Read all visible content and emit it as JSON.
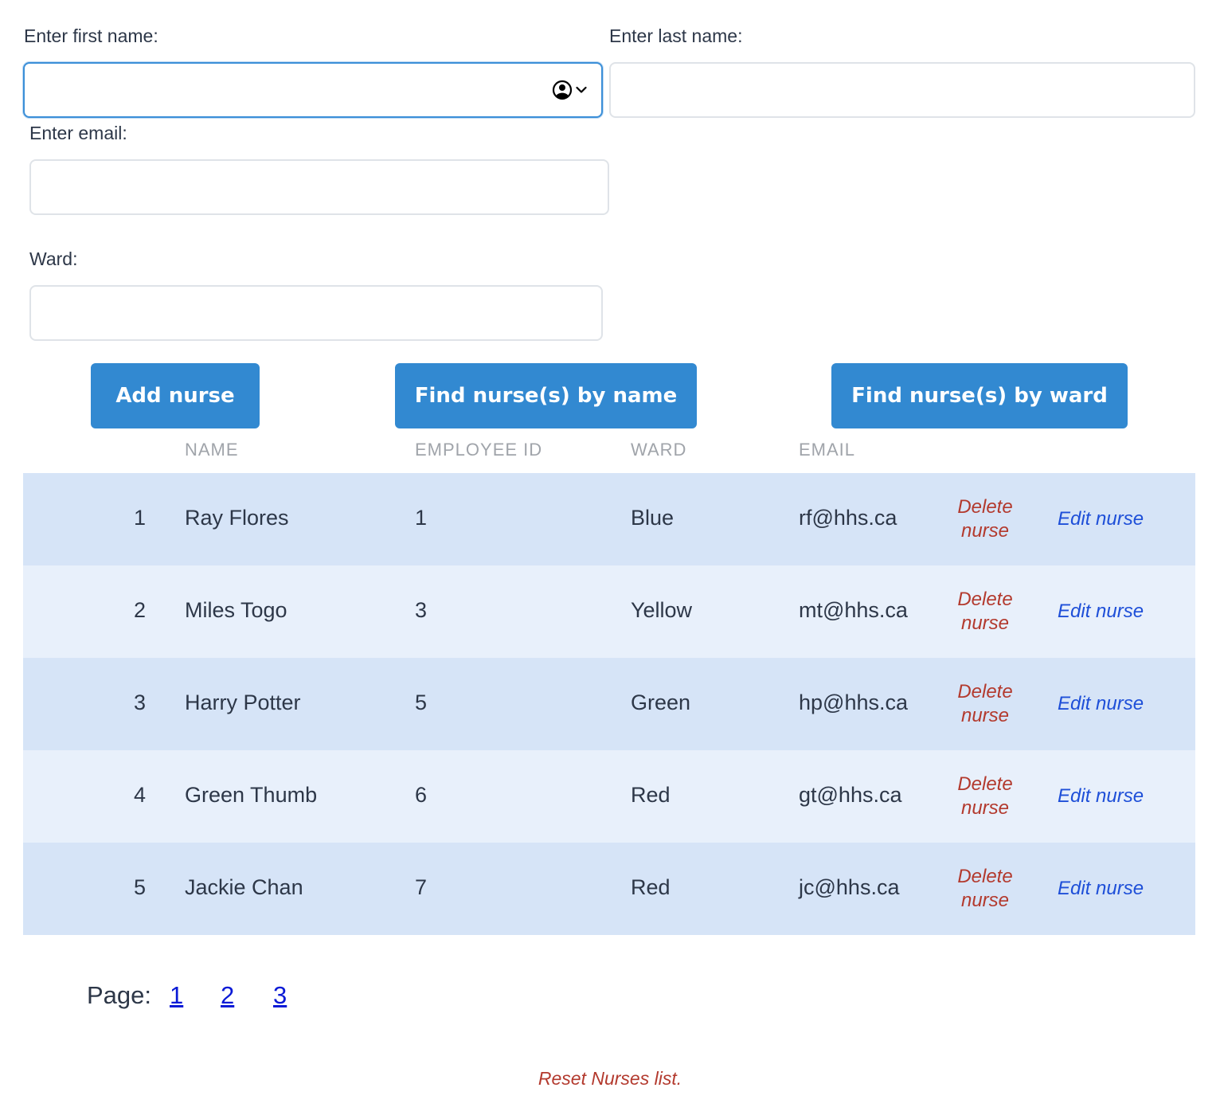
{
  "form": {
    "first_name_label": "Enter first name:",
    "last_name_label": "Enter last name:",
    "email_label": "Enter email:",
    "ward_label": "Ward:",
    "first_name_value": "",
    "last_name_value": "",
    "email_value": "",
    "ward_value": ""
  },
  "buttons": {
    "add": "Add nurse",
    "find_by_name": "Find nurse(s) by name",
    "find_by_ward": "Find nurse(s) by ward"
  },
  "table": {
    "headers": [
      "NAME",
      "EMPLOYEE ID",
      "WARD",
      "EMAIL"
    ],
    "rows": [
      {
        "index": "1",
        "name": "Ray Flores",
        "employee_id": "1",
        "ward": "Blue",
        "email": "rf@hhs.ca",
        "delete": "Delete nurse",
        "edit": "Edit nurse"
      },
      {
        "index": "2",
        "name": "Miles Togo",
        "employee_id": "3",
        "ward": "Yellow",
        "email": "mt@hhs.ca",
        "delete": "Delete nurse",
        "edit": "Edit nurse"
      },
      {
        "index": "3",
        "name": "Harry Potter",
        "employee_id": "5",
        "ward": "Green",
        "email": "hp@hhs.ca",
        "delete": "Delete nurse",
        "edit": "Edit nurse"
      },
      {
        "index": "4",
        "name": "Green Thumb",
        "employee_id": "6",
        "ward": "Red",
        "email": "gt@hhs.ca",
        "delete": "Delete nurse",
        "edit": "Edit nurse"
      },
      {
        "index": "5",
        "name": "Jackie Chan",
        "employee_id": "7",
        "ward": "Red",
        "email": "jc@hhs.ca",
        "delete": "Delete nurse",
        "edit": "Edit nurse"
      }
    ]
  },
  "pagination": {
    "label": "Page:",
    "pages": [
      "1",
      "2",
      "3"
    ]
  },
  "reset_label": "Reset Nurses list.",
  "icons": {
    "autofill": "contact-autofill-icon"
  },
  "colors": {
    "button": "#3289d1",
    "row_dark": "#d6e4f7",
    "row_light": "#e8f0fb",
    "delete": "#b33a2e",
    "edit": "#1e4fd8",
    "page_link": "#0a1ad6"
  }
}
